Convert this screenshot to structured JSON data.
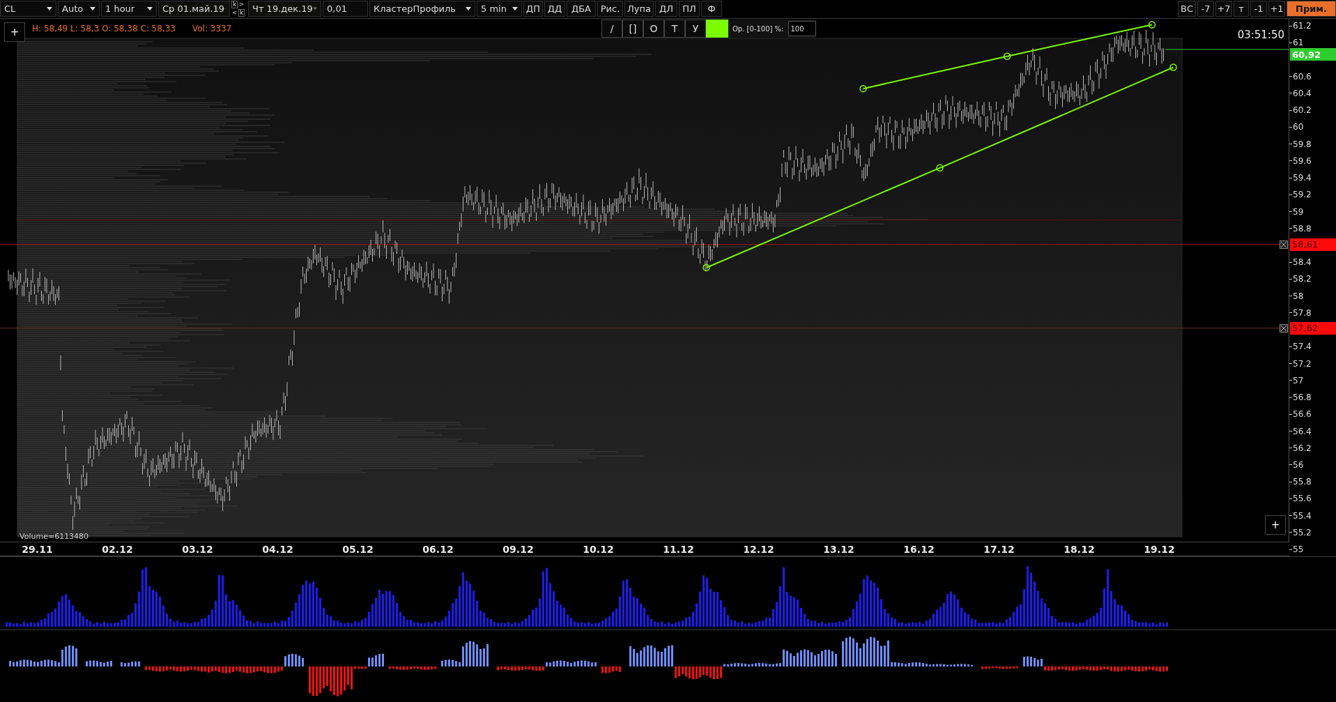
{
  "toolbar": {
    "items": [
      {
        "kind": "dropdown",
        "label": "CL"
      },
      {
        "kind": "dropdown",
        "label": "Auto"
      },
      {
        "kind": "dropdown",
        "label": "1 hour"
      },
      {
        "kind": "date",
        "label": "Ср 01.май.19"
      },
      {
        "kind": "stepper",
        "next": ">",
        "prev": "<",
        "top": "k",
        "bottom": "k"
      },
      {
        "kind": "date",
        "label": "Чт 19.дек.19"
      },
      {
        "kind": "field",
        "label": "0,01"
      },
      {
        "kind": "dropdown",
        "label": "КластерПрофиль"
      },
      {
        "kind": "dropdown",
        "label": "5 min"
      },
      {
        "kind": "button",
        "label": "ДП"
      },
      {
        "kind": "button",
        "label": "ДД"
      },
      {
        "kind": "button",
        "label": "ДБА"
      },
      {
        "kind": "button",
        "label": "Рис."
      },
      {
        "kind": "button",
        "label": "Лупа"
      },
      {
        "kind": "button",
        "label": "ДЛ"
      },
      {
        "kind": "button",
        "label": "ПЛ"
      },
      {
        "kind": "button",
        "label": "Ф"
      }
    ],
    "right_buttons": [
      {
        "kind": "button",
        "label": "ВС"
      },
      {
        "kind": "button",
        "label": "-7"
      },
      {
        "kind": "button",
        "label": "+7"
      },
      {
        "kind": "button",
        "label": "т"
      },
      {
        "kind": "button",
        "label": "-1"
      },
      {
        "kind": "button",
        "label": "+1"
      },
      {
        "kind": "accent",
        "label": "Прим."
      }
    ]
  },
  "chart": {
    "add_button": "+",
    "ohlc": "H: 58,49 L: 58,3 O: 58,38 C: 58,33",
    "volume_info": "Vol: 3337",
    "time": "03:51:50",
    "volume_total": "Volume=6113480",
    "zoom_button": "+"
  },
  "drawing_toolbar": {
    "tools": [
      "/",
      "[]",
      "O",
      "Т",
      "У"
    ],
    "color": "#7cfc00",
    "opacity_label": "Ор. [0-100] %:",
    "opacity_value": "100"
  },
  "price_axis": {
    "ticks": [
      "61.2",
      "61",
      "60.6",
      "60.4",
      "60.2",
      "60",
      "59.8",
      "59.6",
      "59.4",
      "59.2",
      "59",
      "58.8",
      "58.4",
      "58.2",
      "58",
      "57.8",
      "57.4",
      "57.2",
      "57",
      "56.8",
      "56.6",
      "56.4",
      "56.2",
      "56",
      "55.8",
      "55.6",
      "55.4",
      "55.2",
      "55"
    ],
    "markers": [
      {
        "kind": "current",
        "label": "60,92"
      },
      {
        "kind": "level",
        "label": "58,61"
      },
      {
        "kind": "level",
        "label": "57,62"
      }
    ]
  },
  "date_axis": [
    "29.11",
    "02.12",
    "03.12",
    "04.12",
    "05.12",
    "06.12",
    "09.12",
    "10.12",
    "11.12",
    "12.12",
    "13.12",
    "16.12",
    "17.12",
    "18.12",
    "19.12"
  ]
}
